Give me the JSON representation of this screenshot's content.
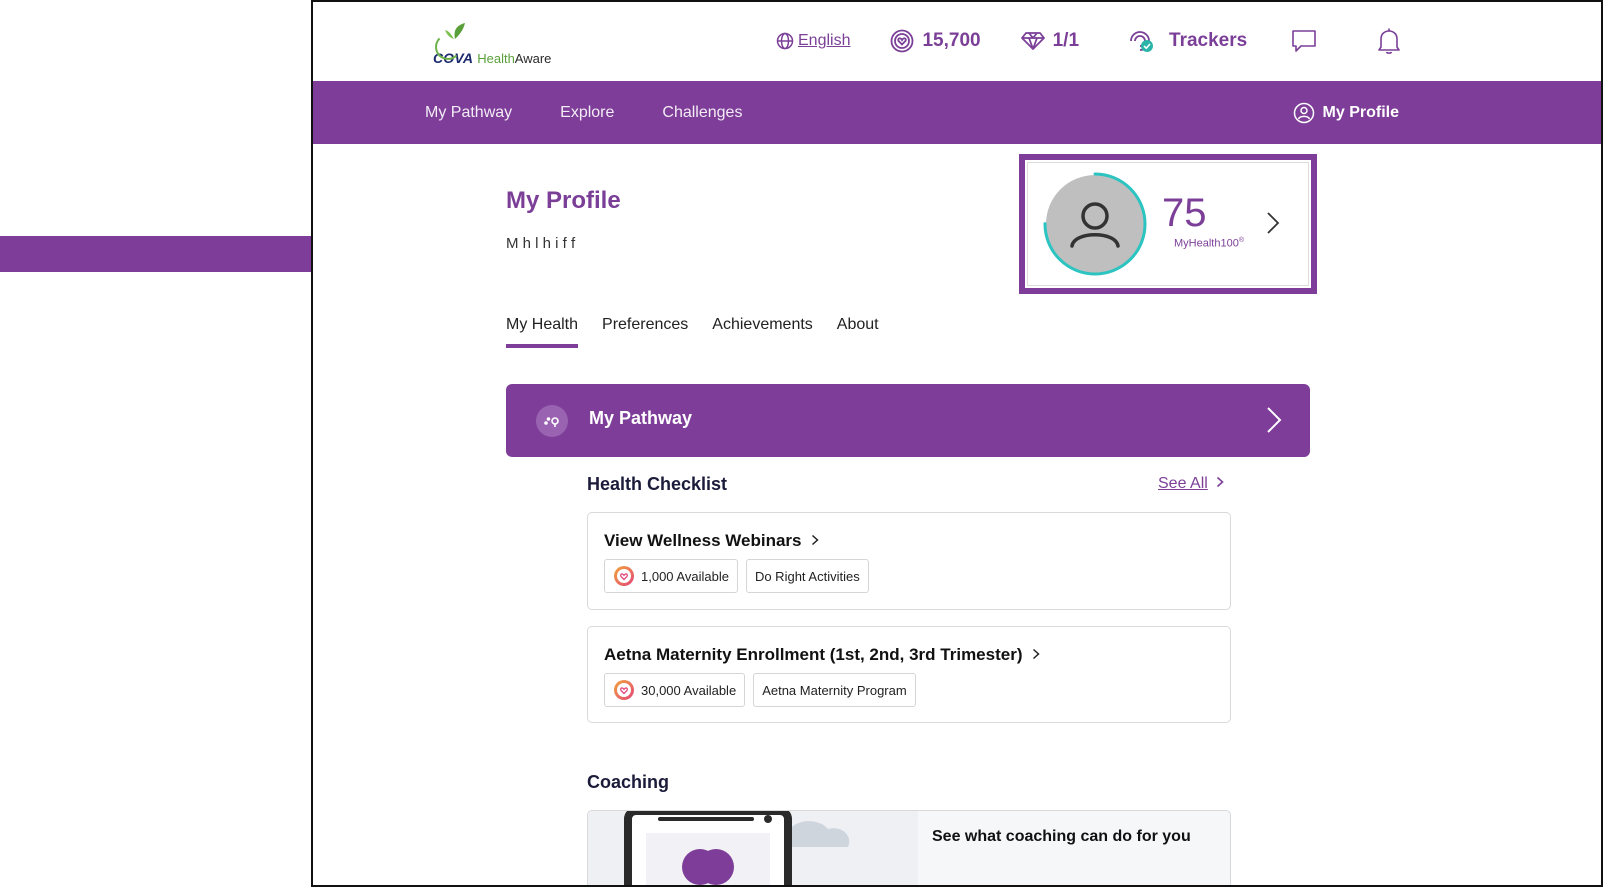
{
  "brand": {
    "logo_cova": "COVA",
    "logo_health": "Health",
    "logo_aware": "Aware"
  },
  "topbar": {
    "language": "English",
    "points": "15,700",
    "gems": "1/1",
    "trackers": "Trackers"
  },
  "navbar": {
    "links": [
      "My Pathway",
      "Explore",
      "Challenges"
    ],
    "profile": "My Profile"
  },
  "profile": {
    "title": "My Profile",
    "subtitle": "M                  h   l  h i f                    f",
    "score": "75",
    "score_label": "MyHealth100",
    "score_mark": "®",
    "score_progress": 0.75
  },
  "tabs": [
    "My Health",
    "Preferences",
    "Achievements",
    "About"
  ],
  "pathway": {
    "label": "My Pathway"
  },
  "checklist": {
    "title": "Health Checklist",
    "see_all": "See All",
    "items": [
      {
        "title": "View Wellness Webinars",
        "reward": "1,000 Available",
        "tag": "Do Right Activities"
      },
      {
        "title": "Aetna Maternity Enrollment (1st, 2nd, 3rd Trimester)",
        "reward": "30,000 Available",
        "tag": "Aetna Maternity Program"
      }
    ]
  },
  "coaching": {
    "title": "Coaching",
    "card_text": "See what coaching can do for you"
  },
  "colors": {
    "brand_purple": "#7d3d98",
    "ring_teal": "#2bc4c0",
    "cova_navy": "#1a2a6c",
    "leaf_green": "#5aa03a"
  }
}
